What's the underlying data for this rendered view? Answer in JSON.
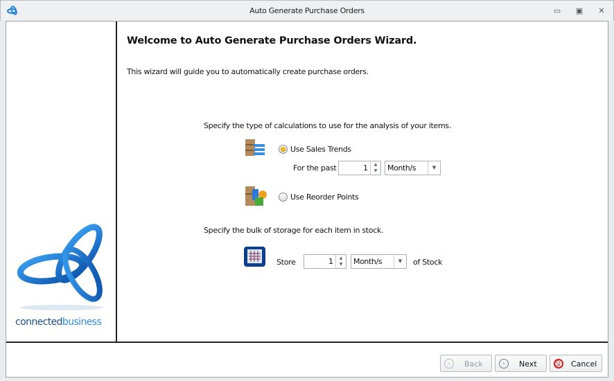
{
  "window": {
    "title": "Auto Generate Purchase Orders",
    "controls": [
      "minimize",
      "restore",
      "close"
    ]
  },
  "logo": {
    "text_a": "connected",
    "text_b": "business"
  },
  "heading": "Welcome to Auto Generate Purchase Orders Wizard.",
  "intro": "This wizard will guide you to automatically create purchase orders.",
  "calc": {
    "prompt": "Specify the type of calculations to use for the analysis of your items.",
    "sales_trends_label": "Use Sales Trends",
    "sales_trends_selected": true,
    "for_past_label": "For the past",
    "for_past_value": "1",
    "for_past_unit": "Month/s",
    "reorder_label": "Use Reorder Points",
    "reorder_selected": false
  },
  "storage": {
    "prompt": "Specify the bulk of storage for each item in stock.",
    "store_label": "Store",
    "store_value": "1",
    "store_unit": "Month/s",
    "suffix": "of Stock"
  },
  "buttons": {
    "back": "Back",
    "next": "Next",
    "cancel": "Cancel"
  }
}
